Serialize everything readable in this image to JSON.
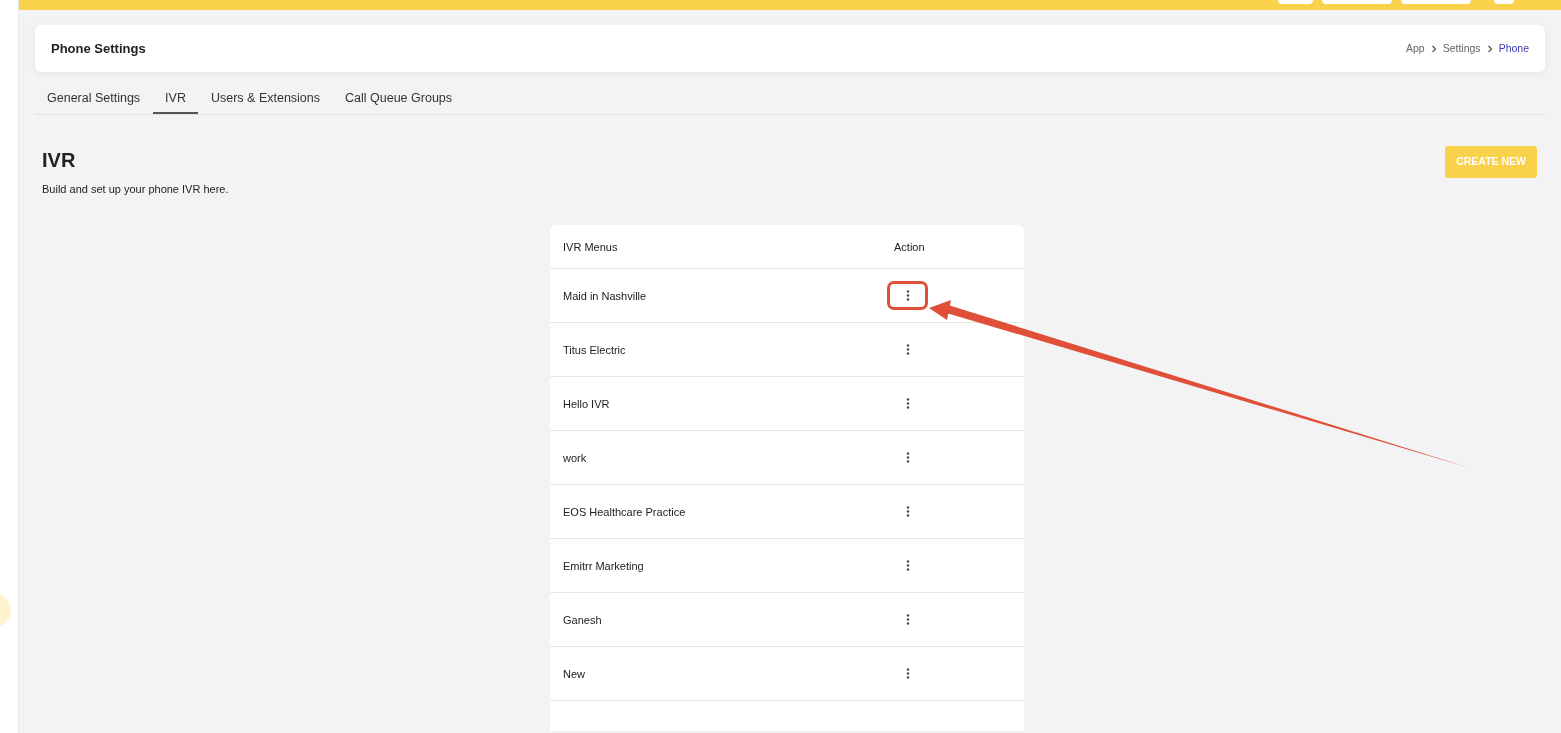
{
  "header": {
    "title": "Phone Settings",
    "breadcrumb": [
      {
        "label": "App",
        "current": false
      },
      {
        "label": "Settings",
        "current": false
      },
      {
        "label": "Phone",
        "current": true
      }
    ]
  },
  "tabs": [
    {
      "label": "General Settings",
      "selected": false
    },
    {
      "label": "IVR",
      "selected": true
    },
    {
      "label": "Users & Extensions",
      "selected": false
    },
    {
      "label": "Call Queue Groups",
      "selected": false
    }
  ],
  "section": {
    "title": "IVR",
    "subtitle": "Build and set up your phone IVR here.",
    "button": "CREATE NEW"
  },
  "table": {
    "columns": [
      "IVR Menus",
      "Action"
    ],
    "rows": [
      {
        "name": "Maid in Nashville",
        "annotated": true
      },
      {
        "name": "Titus Electric",
        "annotated": false
      },
      {
        "name": "Hello IVR",
        "annotated": false
      },
      {
        "name": "work",
        "annotated": false
      },
      {
        "name": "EOS Healthcare Practice",
        "annotated": false
      },
      {
        "name": "Emitrr Marketing",
        "annotated": false
      },
      {
        "name": "Ganesh",
        "annotated": false
      },
      {
        "name": "New",
        "annotated": false
      }
    ]
  }
}
